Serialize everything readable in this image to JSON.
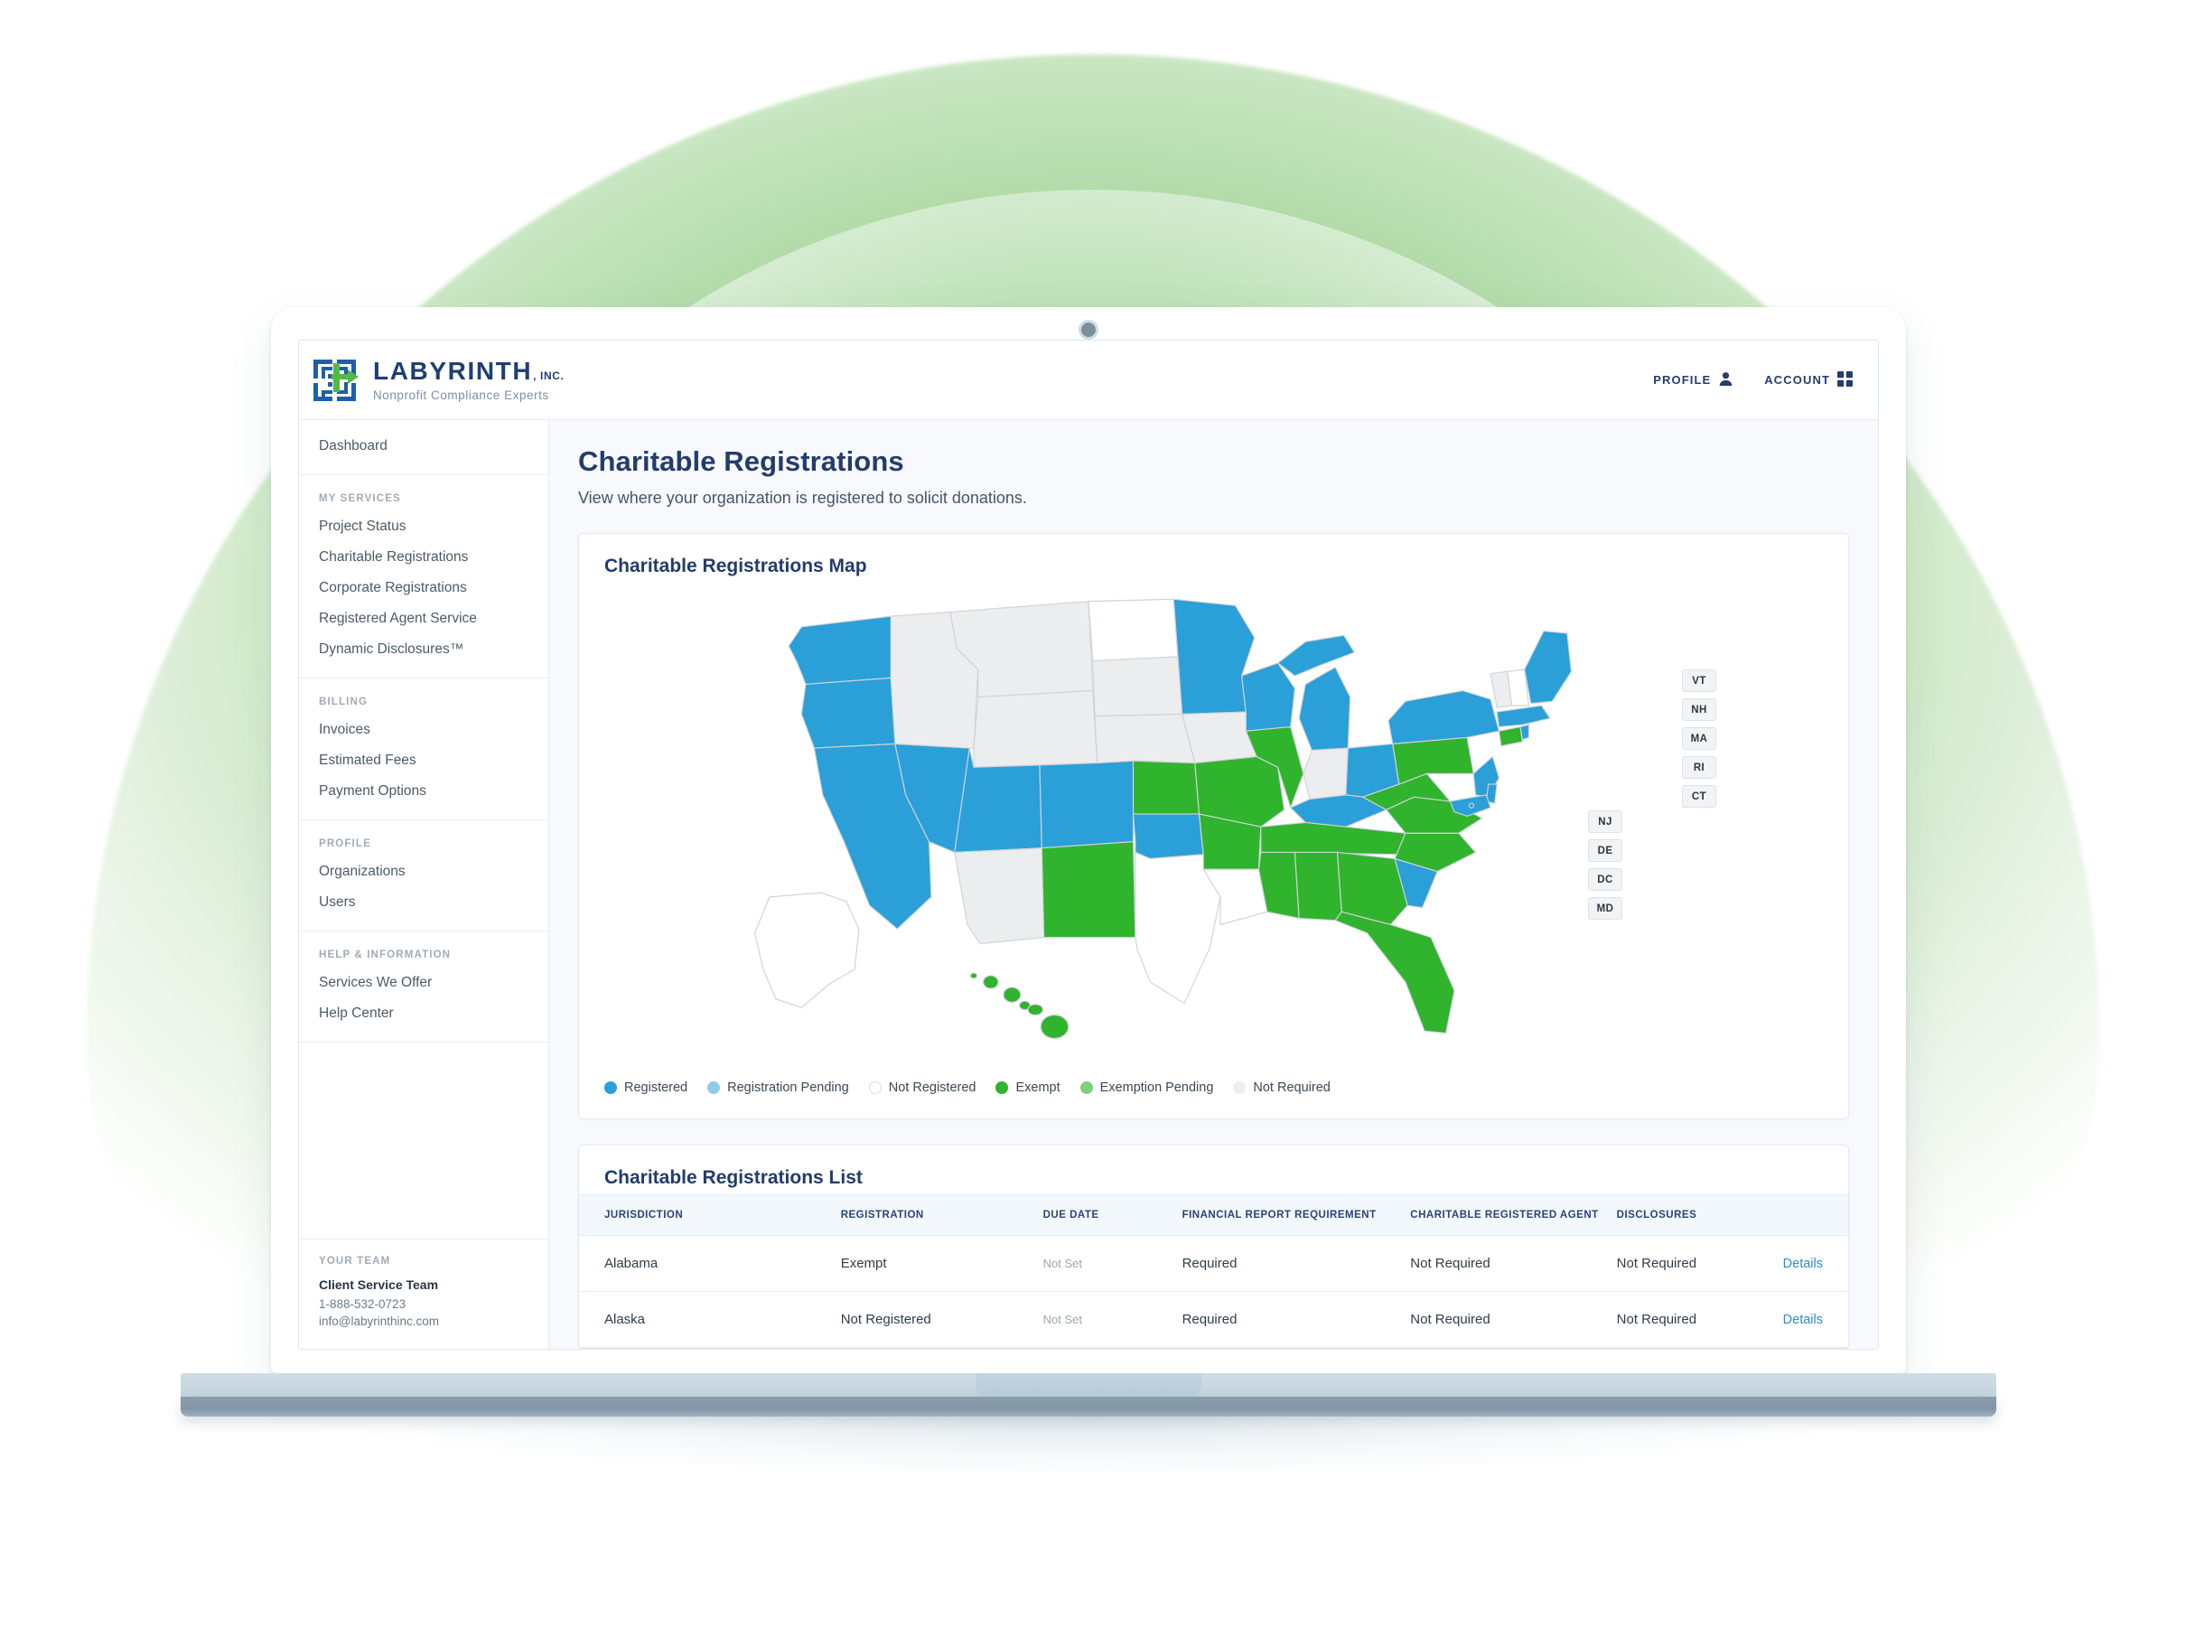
{
  "brand": {
    "name": "LABYRINTH",
    "suffix": ", INC.",
    "tagline": "Nonprofit Compliance Experts"
  },
  "header": {
    "profile_label": "PROFILE",
    "account_label": "ACCOUNT"
  },
  "sidebar": {
    "top_item": "Dashboard",
    "groups": [
      {
        "heading": "MY SERVICES",
        "items": [
          "Project Status",
          "Charitable Registrations",
          "Corporate Registrations",
          "Registered Agent Service",
          "Dynamic Disclosures™"
        ]
      },
      {
        "heading": "BILLING",
        "items": [
          "Invoices",
          "Estimated Fees",
          "Payment Options"
        ]
      },
      {
        "heading": "PROFILE",
        "items": [
          "Organizations",
          "Users"
        ]
      },
      {
        "heading": "HELP & INFORMATION",
        "items": [
          "Services We Offer",
          "Help Center"
        ]
      }
    ],
    "team": {
      "heading": "YOUR TEAM",
      "name": "Client Service Team",
      "phone": "1-888-532-0723",
      "email": "info@labyrinthinc.com"
    }
  },
  "page": {
    "title": "Charitable Registrations",
    "subtitle": "View where your organization is registered to solicit donations."
  },
  "map_card": {
    "title": "Charitable Registrations Map",
    "legend": [
      {
        "label": "Registered",
        "color": "#2a9fd8"
      },
      {
        "label": "Registration Pending",
        "color": "#8dcdea"
      },
      {
        "label": "Not Registered",
        "color": "#ffffff"
      },
      {
        "label": "Exempt",
        "color": "#30b32d"
      },
      {
        "label": "Exemption Pending",
        "color": "#7fd07c"
      },
      {
        "label": "Not Required",
        "color": "#ebedef"
      }
    ],
    "state_boxes_northeast": [
      "VT",
      "NH",
      "MA",
      "RI",
      "CT"
    ],
    "state_boxes_midatlantic": [
      "NJ",
      "DE",
      "DC",
      "MD"
    ],
    "state_status": {
      "WA": "Registered",
      "OR": "Registered",
      "CA": "Registered",
      "NV": "Registered",
      "UT": "Registered",
      "CO": "Registered",
      "ID": "Not Required",
      "MT": "Not Required",
      "WY": "Not Required",
      "AZ": "Not Required",
      "NM": "Exempt",
      "ND": "Not Registered",
      "SD": "Not Required",
      "NE": "Not Required",
      "KS": "Exempt",
      "OK": "Registered",
      "TX": "Not Registered",
      "MN": "Registered",
      "IA": "Not Required",
      "MO": "Exempt",
      "AR": "Exempt",
      "LA": "Not Registered",
      "WI": "Registered",
      "IL": "Exempt",
      "MI": "Registered",
      "IN": "Not Required",
      "OH": "Registered",
      "KY": "Registered",
      "TN": "Exempt",
      "MS": "Exempt",
      "AL": "Exempt",
      "GA": "Exempt",
      "FL": "Exempt",
      "SC": "Registered",
      "NC": "Exempt",
      "VA": "Exempt",
      "WV": "Exempt",
      "PA": "Exempt",
      "NY": "Registered",
      "NJ": "Registered",
      "DE": "Registered",
      "MD": "Registered",
      "CT": "Exempt",
      "RI": "Registered",
      "MA": "Registered",
      "VT": "Not Required",
      "NH": "Not Registered",
      "ME": "Registered",
      "AK": "Not Registered",
      "HI": "Exempt"
    }
  },
  "list_card": {
    "title": "Charitable Registrations List",
    "columns": [
      "JURISDICTION",
      "REGISTRATION",
      "DUE DATE",
      "FINANCIAL REPORT REQUIREMENT",
      "CHARITABLE REGISTERED AGENT",
      "DISCLOSURES",
      ""
    ],
    "rows": [
      {
        "jurisdiction": "Alabama",
        "registration": "Exempt",
        "due_date": "Not Set",
        "financial_report": "Required",
        "registered_agent": "Not Required",
        "disclosures": "Not Required",
        "action": "Details"
      },
      {
        "jurisdiction": "Alaska",
        "registration": "Not Registered",
        "due_date": "Not Set",
        "financial_report": "Required",
        "registered_agent": "Not Required",
        "disclosures": "Not Required",
        "action": "Details"
      }
    ]
  }
}
